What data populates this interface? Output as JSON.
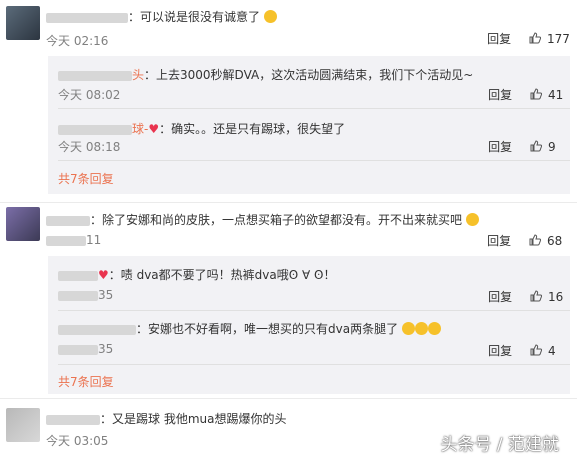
{
  "comments": [
    {
      "text": "：可以说是很没有诚意了",
      "time": "今天 02:16",
      "reply_label": "回复",
      "likes": "177",
      "replies": [
        {
          "name_suffix": "头",
          "text": "：上去3000秒解DVA，这次活动圆满结束，我们下个活动见~",
          "time": "今天 08:02",
          "reply_label": "回复",
          "likes": "41"
        },
        {
          "name_suffix": "球-",
          "text": "：确实。。还是只有踢球，很失望了",
          "time": "今天 08:18",
          "reply_label": "回复",
          "likes": "9"
        }
      ],
      "more_label": "共7条回复"
    },
    {
      "text": "：除了安娜和尚的皮肤，一点想买箱子的欲望都没有。开不出来就买吧",
      "time": "11",
      "reply_label": "回复",
      "likes": "68",
      "replies": [
        {
          "text": "：啧 dva都不要了吗！热裤dva哦ʘ ∀ ʘ！",
          "time": "35",
          "reply_label": "回复",
          "likes": "16"
        },
        {
          "text": "：安娜也不好看啊，唯一想买的只有dva两条腿了",
          "time": "35",
          "reply_label": "回复",
          "likes": "4"
        }
      ],
      "more_label": "共7条回复"
    },
    {
      "text": "：又是踢球 我他mua想踢爆你的头",
      "time": "今天 03:05"
    }
  ],
  "watermark": "头条号 / 范建就",
  "colors": {
    "name": "#eb7350",
    "muted": "#808080",
    "reply_bg": "#f2f2f5"
  }
}
